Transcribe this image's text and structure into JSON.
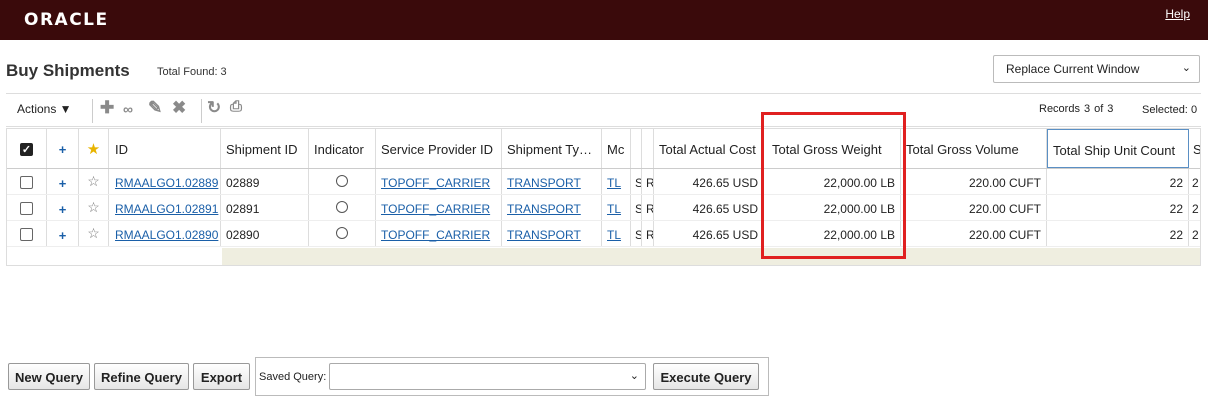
{
  "header": {
    "logo_text": "ORACLE",
    "help_label": "Help"
  },
  "page": {
    "title": "Buy Shipments",
    "total_found_label": "Total Found:",
    "total_found_value": "3"
  },
  "window_select": {
    "value": "Replace Current Window"
  },
  "toolbar": {
    "actions_label": "Actions ▼",
    "icons": [
      "add-icon",
      "view-icon",
      "edit-icon",
      "delete-icon",
      "refresh-icon",
      "print-icon"
    ],
    "records_label": "Records",
    "records_current": "3",
    "records_of": "of",
    "records_total": "3",
    "selected_label": "Selected:",
    "selected_value": "0"
  },
  "grid": {
    "headers": {
      "id": "ID",
      "shipment_id": "Shipment ID",
      "indicator": "Indicator",
      "service_provider_id": "Service Provider ID",
      "shipment_type": "Shipment Ty…",
      "mode": "Mc",
      "total_actual_cost": "Total Actual Cost",
      "total_gross_weight": "Total Gross Weight",
      "total_gross_volume": "Total Gross Volume",
      "total_ship_unit_count": "Total Ship Unit Count",
      "extra": "S"
    },
    "rows": [
      {
        "id": "RMAALGO1.02889",
        "shipment_id": "02889",
        "service_provider_id": "TOPOFF_CARRIER",
        "shipment_type": "TRANSPORT",
        "mode": "TL",
        "c1": "S",
        "c2": "R",
        "total_actual_cost": "426.65 USD",
        "total_gross_weight": "22,000.00 LB",
        "total_gross_volume": "220.00 CUFT",
        "total_ship_unit_count": "22",
        "extra": "2"
      },
      {
        "id": "RMAALGO1.02891",
        "shipment_id": "02891",
        "service_provider_id": "TOPOFF_CARRIER",
        "shipment_type": "TRANSPORT",
        "mode": "TL",
        "c1": "S",
        "c2": "R",
        "total_actual_cost": "426.65 USD",
        "total_gross_weight": "22,000.00 LB",
        "total_gross_volume": "220.00 CUFT",
        "total_ship_unit_count": "22",
        "extra": "2"
      },
      {
        "id": "RMAALGO1.02890",
        "shipment_id": "02890",
        "service_provider_id": "TOPOFF_CARRIER",
        "shipment_type": "TRANSPORT",
        "mode": "TL",
        "c1": "S",
        "c2": "R",
        "total_actual_cost": "426.65 USD",
        "total_gross_weight": "22,000.00 LB",
        "total_gross_volume": "220.00 CUFT",
        "total_ship_unit_count": "22",
        "extra": "2"
      }
    ]
  },
  "bottom": {
    "new_query": "New Query",
    "refine_query": "Refine Query",
    "export": "Export",
    "saved_query_label": "Saved Query:",
    "saved_query_value": "",
    "execute_query": "Execute Query"
  },
  "colors": {
    "header_bg": "#3a0a0b",
    "link": "#1a5fa8",
    "highlight": "#e02020",
    "star": "#e8b400"
  }
}
